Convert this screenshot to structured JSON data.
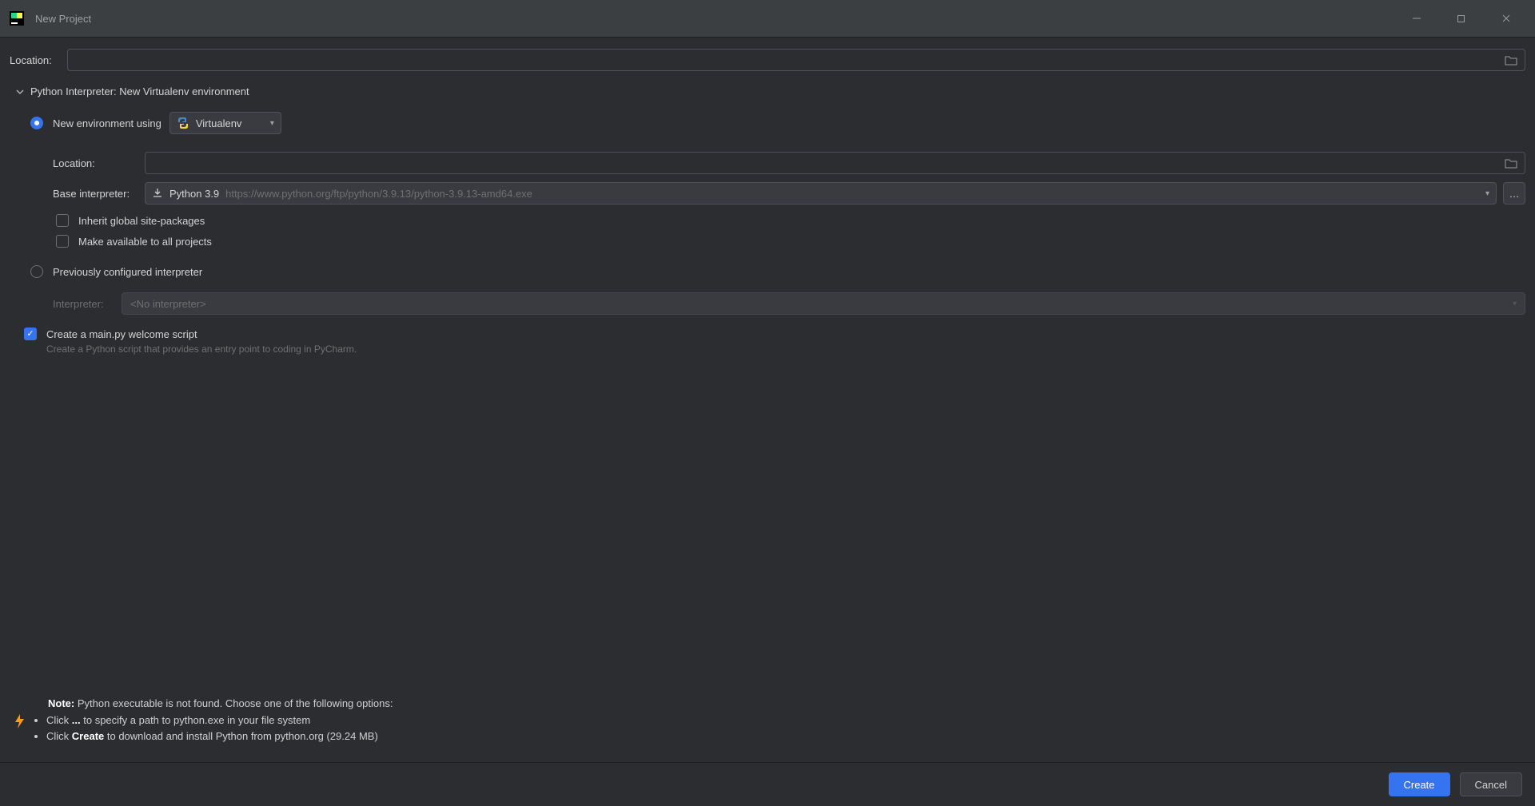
{
  "window": {
    "title": "New Project"
  },
  "location": {
    "label": "Location:",
    "value": ""
  },
  "interpreter_section": {
    "header": "Python Interpreter: New Virtualenv environment"
  },
  "new_env": {
    "radio_label": "New environment using",
    "env_type": "Virtualenv",
    "location_label": "Location:",
    "location_value": "",
    "base_label": "Base interpreter:",
    "base_name": "Python 3.9",
    "base_hint": "https://www.python.org/ftp/python/3.9.13/python-3.9.13-amd64.exe",
    "inherit_label": "Inherit global site-packages",
    "make_avail_label": "Make available to all projects"
  },
  "prev_interp": {
    "radio_label": "Previously configured interpreter",
    "interp_label": "Interpreter:",
    "no_interp_text": "<No interpreter>"
  },
  "welcome": {
    "check_label": "Create a main.py welcome script",
    "desc": "Create a Python script that provides an entry point to coding in PyCharm."
  },
  "note": {
    "prefix": "Note:",
    "text": " Python executable is not found. Choose one of the following options:",
    "bullet1_pre": "Click ",
    "bullet1_bold": "...",
    "bullet1_post": " to specify a path to python.exe in your file system",
    "bullet2_pre": "Click ",
    "bullet2_bold": "Create",
    "bullet2_post": " to download and install Python from python.org (29.24 MB)"
  },
  "footer": {
    "create": "Create",
    "cancel": "Cancel"
  }
}
